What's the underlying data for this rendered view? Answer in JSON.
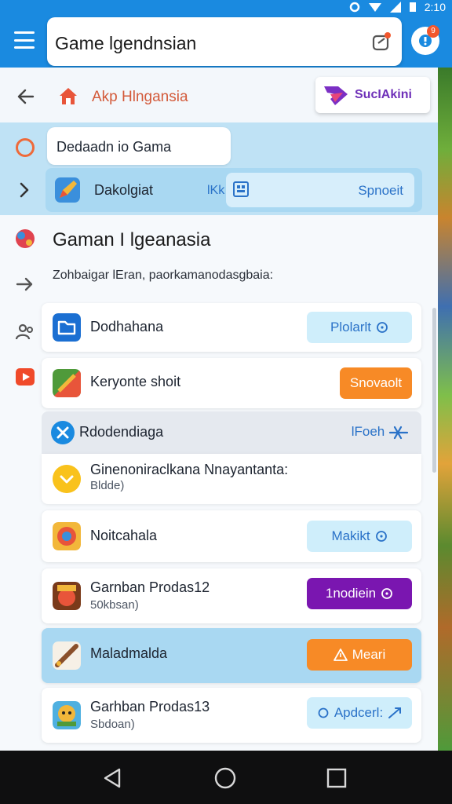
{
  "status_bar": {
    "time": "2:10"
  },
  "app_bar": {
    "search_value": "Game lgendnsian",
    "notification_count": "9"
  },
  "sub_header": {
    "title": "Akp Hlngansia",
    "brand_label": "SucIAkini"
  },
  "filter": {
    "input_value": "Dedaadn io Gama"
  },
  "strip": {
    "label": "Dakolgiat",
    "tag": "lKk",
    "box_label": "Spnoeit"
  },
  "section": {
    "title": "Gaman I lgeanasia",
    "subtitle": "Zohbaigar lEran, paorkamanodasgbaia:"
  },
  "cards": [
    {
      "name": "Dodhahana",
      "action": "Plolarlt"
    },
    {
      "name": "Keryonte shoit",
      "action": "Snovaolt"
    },
    {
      "name": "Noitcahala",
      "action": "Makikt"
    },
    {
      "name": "Garnban Prodas12",
      "meta": "50kbsan)",
      "action": "1nodiein"
    },
    {
      "name": "Maladmalda",
      "action": "Meari"
    },
    {
      "name": "Garhban Prodas13",
      "meta": "Sbdoan)",
      "action": "Apdcerl:"
    }
  ],
  "group": {
    "header_label": "Rdodendiaga",
    "header_action": "lFoeh",
    "item_name": "Ginenoniraclkana Nnayantanta:",
    "item_meta": "Bldde)"
  },
  "colors": {
    "primary": "#1a8ae0",
    "accent_orange": "#f78a26",
    "accent_purple": "#7a16b0",
    "light_blue": "#bfe2f5"
  }
}
